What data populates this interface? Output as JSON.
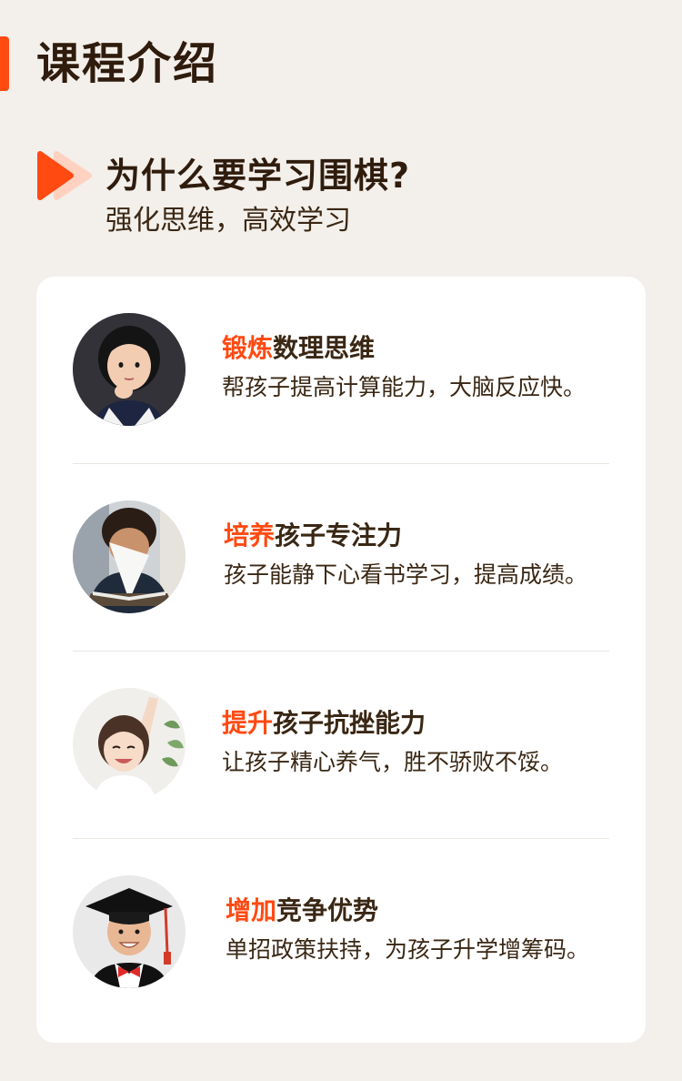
{
  "page": {
    "title": "课程介绍",
    "accent_color": "#ff4a12",
    "background_color": "#f3efea"
  },
  "section": {
    "icon": "play-icon",
    "title": "为什么要学习围棋?",
    "subtitle": "强化思维，高效学习"
  },
  "features": [
    {
      "avatar": "thinking-girl-photo",
      "title_highlight": "锻炼",
      "title_rest": "数理思维",
      "description": "帮孩子提高计算能力，大脑反应快。"
    },
    {
      "avatar": "reading-boy-photo",
      "title_highlight": "培养",
      "title_rest": "孩子专注力",
      "description": "孩子能静下心看书学习，提高成绩。"
    },
    {
      "avatar": "hand-raised-girl-photo",
      "title_highlight": "提升",
      "title_rest": "孩子抗挫能力",
      "description": "让孩子精心养气，胜不骄败不馁。"
    },
    {
      "avatar": "graduate-boy-photo",
      "title_highlight": "增加",
      "title_rest": "竞争优势",
      "description": "单招政策扶持，为孩子升学增筹码。"
    }
  ]
}
